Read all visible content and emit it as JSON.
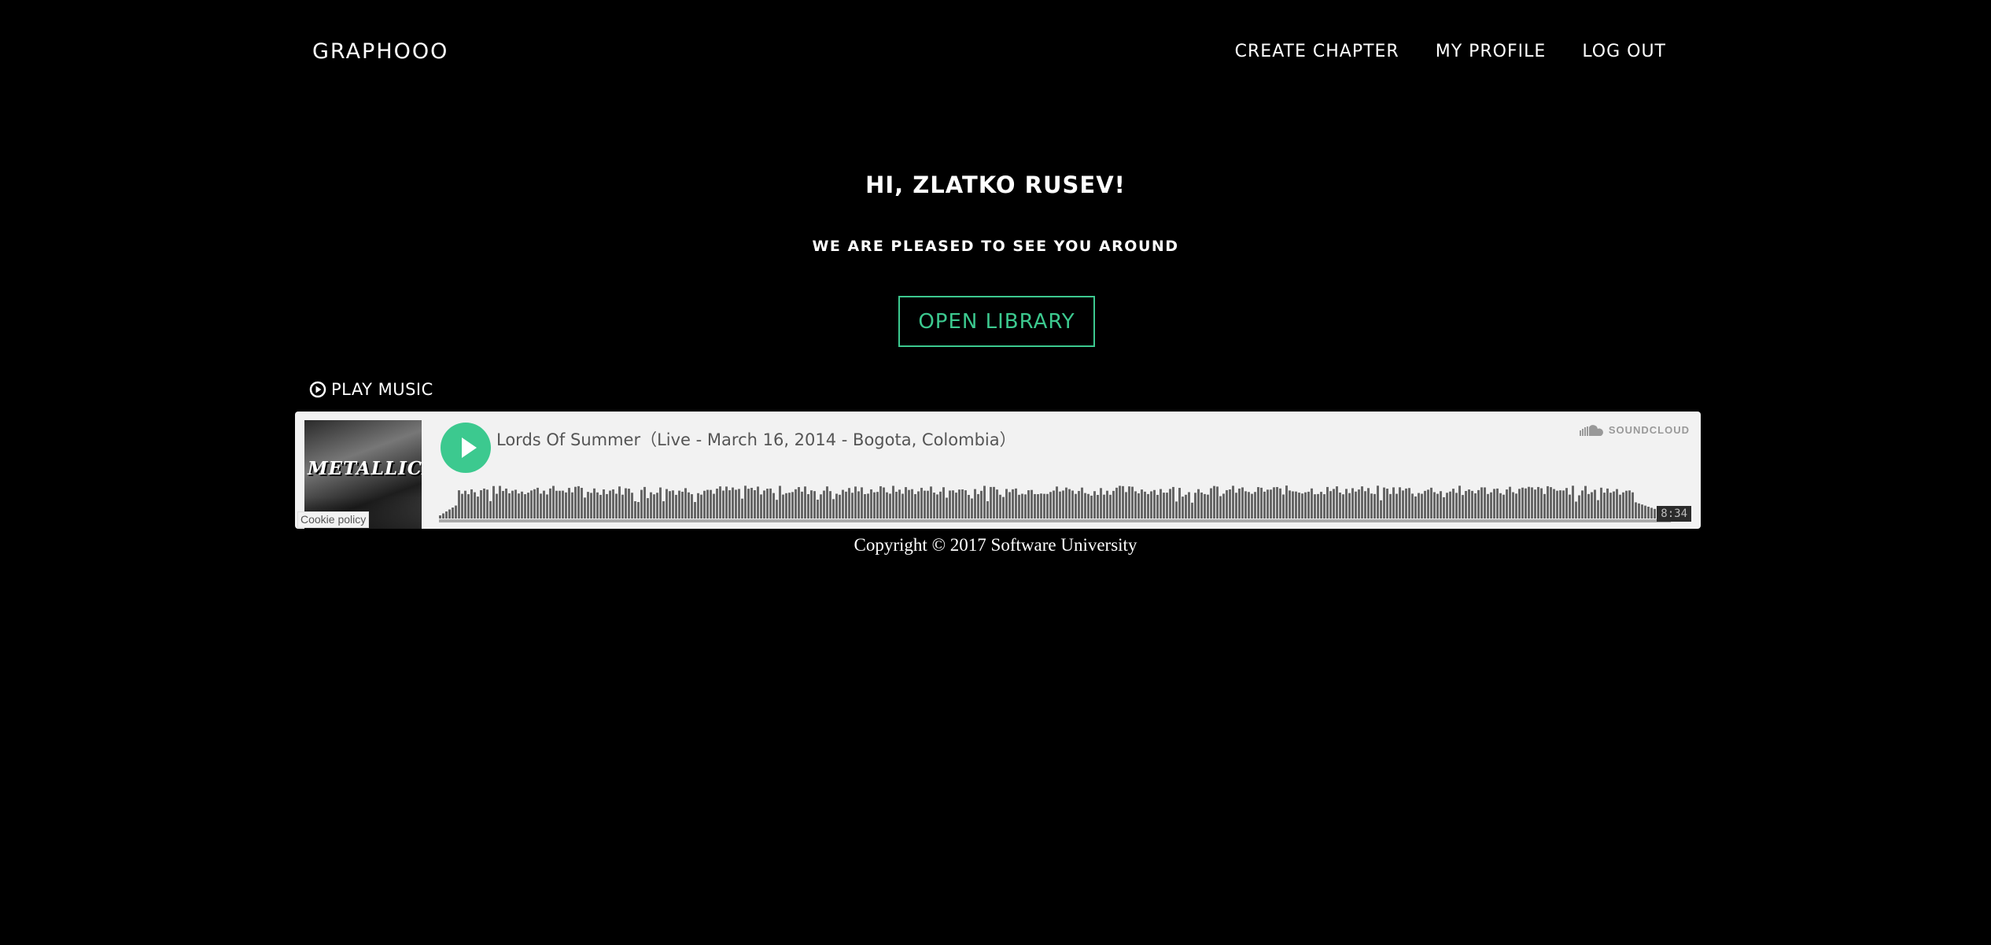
{
  "header": {
    "brand": "GRAPHOOO",
    "nav": [
      "CREATE CHAPTER",
      "MY PROFILE",
      "LOG OUT"
    ]
  },
  "hero": {
    "greeting": "HI, ZLATKO RUSEV!",
    "subtitle": "WE ARE PLEASED TO SEE YOU AROUND",
    "open_library_label": "OPEN LIBRARY"
  },
  "music": {
    "label": "PLAY MUSIC",
    "label_icon": "play-circle-icon"
  },
  "soundcloud": {
    "artwork_text": "METALLICA",
    "track_title": "Lords Of Summer（Live - March 16, 2014 - Bogota, Colombia）",
    "logo_label": "SOUNDCLOUD",
    "logo_icon": "soundcloud-cloud-icon",
    "cookie_policy": "Cookie policy",
    "duration": "8:34",
    "play_icon": "play-icon",
    "accent_color": "#3cc98f"
  },
  "footer": {
    "copyright": "Copyright © 2017 Software University"
  },
  "colors": {
    "background": "#000000",
    "text": "#ffffff",
    "accent": "#3cc98f",
    "widget_bg": "#f2f2f2",
    "waveform": "#666666"
  }
}
